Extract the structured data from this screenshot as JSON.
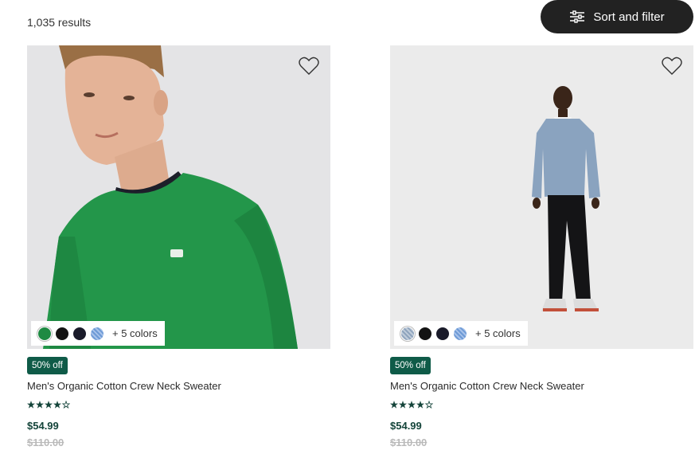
{
  "results_text": "1,035 results",
  "sort_filter_label": "Sort and filter",
  "products": [
    {
      "discount": "50% off",
      "name": "Men's Organic Cotton Crew Neck Sweater",
      "price": "$54.99",
      "original_price": "$110.00",
      "rating_stars": 4,
      "rating_max": 5,
      "swatch_colors": [
        "#1f8a43",
        "#131313",
        "#1a1b2a",
        "#6d9ad6"
      ],
      "more_colors": "+ 5 colors",
      "wishlist_icon": "heart-outline-icon"
    },
    {
      "discount": "50% off",
      "name": "Men's Organic Cotton Crew Neck Sweater",
      "price": "$54.99",
      "original_price": "$110.00",
      "rating_stars": 4,
      "rating_max": 5,
      "swatch_colors": [
        "#8fa4bd",
        "#131313",
        "#1a1b2a",
        "#6d9ad6"
      ],
      "more_colors": "+ 5 colors",
      "wishlist_icon": "heart-outline-icon"
    }
  ],
  "colors": {
    "badge_bg": "#0f5b48",
    "price": "#14443a",
    "star": "#14443a",
    "button_bg": "#222222"
  }
}
